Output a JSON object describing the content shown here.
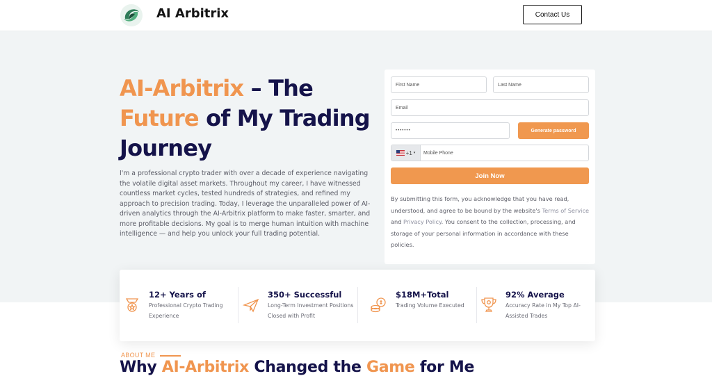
{
  "header": {
    "brand": "AI Arbitrix",
    "contact_label": "Contact Us"
  },
  "hero": {
    "headline_accent_1": "AI-Arbitrix",
    "headline_part_1": " – The ",
    "headline_accent_2": "Future",
    "headline_part_2": " of My Trading Journey",
    "intro": "I'm a professional crypto trader with over a decade of experience navigating the volatile digital asset markets. Throughout my career, I have witnessed countless market cycles, tested hundreds of strategies, and refined my approach to precision trading. Today, I leverage the unparalleled power of AI-driven analytics through the AI-Arbitrix platform to make faster, smarter, and more profitable decisions. My goal is to merge human intuition with machine intelligence — and help you unlock your full trading potential."
  },
  "form": {
    "first_name_placeholder": "First Name",
    "last_name_placeholder": "Last Name",
    "email_placeholder": "Email",
    "password_value": "•••••••",
    "generate_label": "Generate password",
    "phone_code": "+1",
    "phone_placeholder": "Mobile Phone",
    "join_label": "Join Now",
    "consent_part_1": "By submitting this form, you acknowledge that you have read, understood, and agree to be bound by the website's ",
    "terms_link": "Terms of Service",
    "consent_part_2": " and ",
    "privacy_link": "Privacy Policy",
    "consent_part_3": ". You consent to the collection, processing, and storage of your personal information in accordance with these policies."
  },
  "stats": [
    {
      "title": "12+ Years of",
      "desc": "Professional Crypto Trading Experience",
      "icon": "medal-icon"
    },
    {
      "title": "350+ Successful",
      "desc": "Long-Term Investment Positions Closed with Profit",
      "icon": "paper-plane-icon"
    },
    {
      "title": "$18M+Total",
      "desc": "Trading Volume Executed",
      "icon": "coins-icon"
    },
    {
      "title": "92% Average",
      "desc": "Accuracy Rate in My Top AI-Assisted Trades",
      "icon": "trophy-icon"
    }
  ],
  "about": {
    "label": "ABOUT ME",
    "title_part_1": "Why ",
    "title_accent_1": "AI-Arbitrix",
    "title_part_2": " Changed the ",
    "title_accent_2": "Game",
    "title_part_3": " for Me"
  },
  "colors": {
    "accent": "#f0954f",
    "navy": "#15134a",
    "hero_bg": "#f1f4f5"
  }
}
